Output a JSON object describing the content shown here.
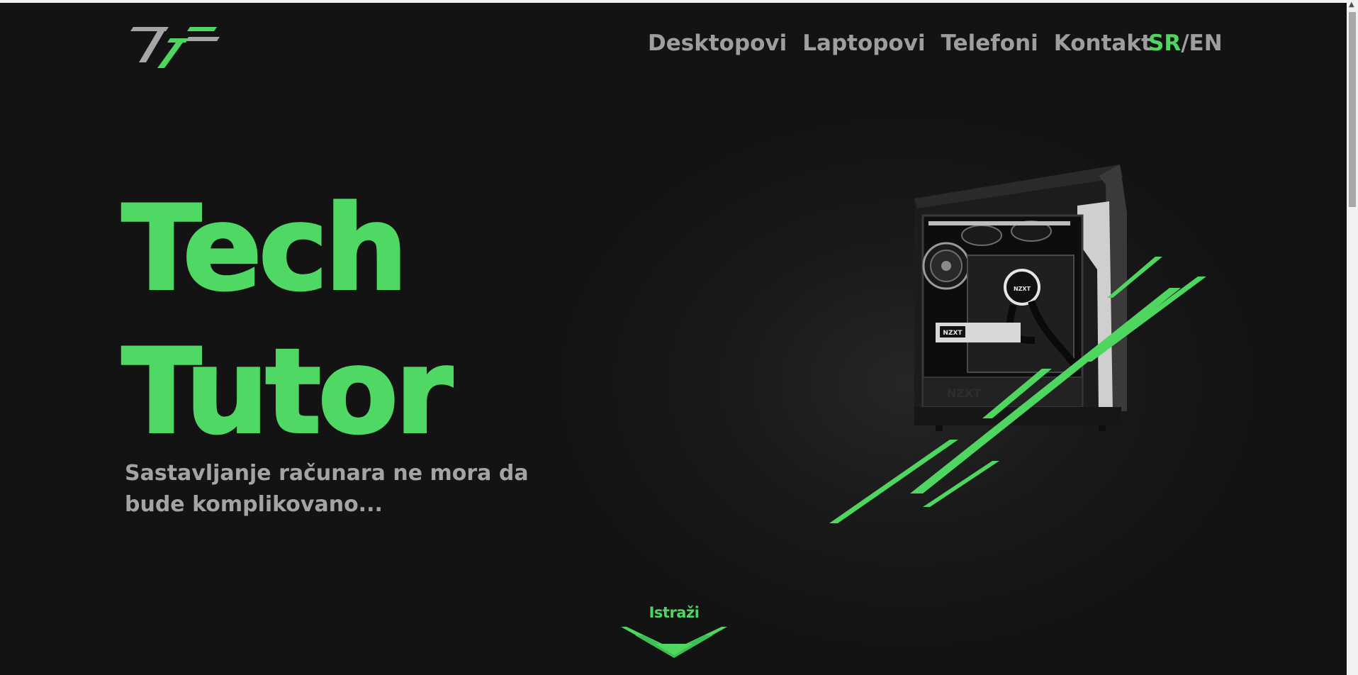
{
  "logo": {
    "icon": "tech-tutor-logo-icon",
    "colors": {
      "gray": "#a6a6a6",
      "green": "#4ed661"
    }
  },
  "nav": {
    "items": [
      {
        "label": "Desktopovi"
      },
      {
        "label": "Laptopovi"
      },
      {
        "label": "Telefoni"
      },
      {
        "label": "Kontakt"
      }
    ]
  },
  "lang": {
    "active": "SR",
    "separator": "/",
    "other": "EN"
  },
  "hero": {
    "title_line1": "Tech",
    "title_line2": "Tutor",
    "subtitle": "Sastavljanje računara ne mora da bude komplikovano..."
  },
  "illustration": {
    "icon": "pc-case-illustration",
    "case_brand": "NZXT"
  },
  "explore": {
    "label": "Istraži",
    "icon": "chevron-down-icon"
  },
  "theme": {
    "background": "#131313",
    "accent": "#4ed661",
    "text_muted": "#9e9e9e"
  }
}
